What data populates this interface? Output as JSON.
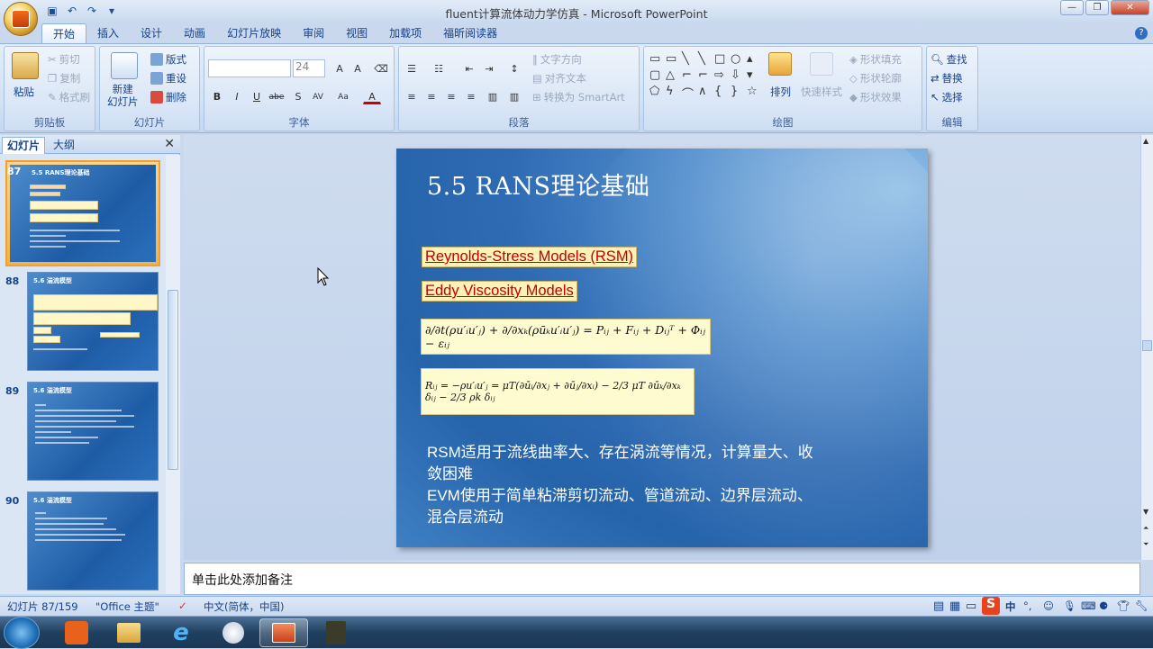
{
  "window": {
    "title": "fluent计算流体动力学仿真 - Microsoft PowerPoint"
  },
  "tabs": [
    "开始",
    "插入",
    "设计",
    "动画",
    "幻灯片放映",
    "审阅",
    "视图",
    "加载项",
    "福昕阅读器"
  ],
  "ribbon": {
    "clipboard": {
      "label": "剪贴板",
      "paste": "粘贴",
      "cut": "剪切",
      "copy": "复制",
      "format_painter": "格式刷"
    },
    "slides": {
      "label": "幻灯片",
      "new_slide": "新建\n幻灯片",
      "layout": "版式",
      "reset": "重设",
      "delete": "删除"
    },
    "font": {
      "label": "字体",
      "size": "24"
    },
    "paragraph": {
      "label": "段落",
      "text_direction": "文字方向",
      "align_text": "对齐文本",
      "smartart": "转换为 SmartArt"
    },
    "drawing": {
      "label": "绘图",
      "arrange": "排列",
      "quick_styles": "快速样式",
      "shape_fill": "形状填充",
      "shape_outline": "形状轮廓",
      "shape_effects": "形状效果"
    },
    "editing": {
      "label": "编辑",
      "find": "查找",
      "replace": "替换",
      "select": "选择"
    }
  },
  "panel": {
    "tab_slides": "幻灯片",
    "tab_outline": "大纲",
    "thumbs": [
      {
        "num": "87",
        "title": "5.5 RANS理论基础"
      },
      {
        "num": "88",
        "title": "5.6 湍流模型"
      },
      {
        "num": "89",
        "title": "5.6 湍流模型"
      },
      {
        "num": "90",
        "title": "5.6 湍流模型"
      }
    ]
  },
  "slide": {
    "title": "5.5 RANS理论基础",
    "rsm": "Reynolds-Stress Models (RSM)",
    "evm": "Eddy Viscosity Models",
    "eq1": "∂/∂t(ρu′ᵢu′ⱼ) + ∂/∂xₖ(ρūₖu′ᵢu′ⱼ) = Pᵢⱼ + Fᵢⱼ + Dᵢⱼᵀ + Φᵢⱼ − εᵢⱼ",
    "eq2": "Rᵢⱼ = −ρu′ᵢu′ⱼ = μT(∂ūᵢ/∂xⱼ + ∂ūⱼ/∂xᵢ) − 2/3 μT ∂ūₖ/∂xₖ δᵢⱼ − 2/3 ρk δᵢⱼ",
    "body1": "RSM适用于流线曲率大、存在涡流等情况，计算量大、收敛困难",
    "body2": "EVM使用于简单粘滞剪切流动、管道流动、边界层流动、混合层流动"
  },
  "notes": {
    "placeholder": "单击此处添加备注"
  },
  "status": {
    "slide_count": "幻灯片 87/159",
    "theme": "\"Office 主题\"",
    "language": "中文(简体，中国)"
  },
  "tray": {
    "ime": "中"
  }
}
